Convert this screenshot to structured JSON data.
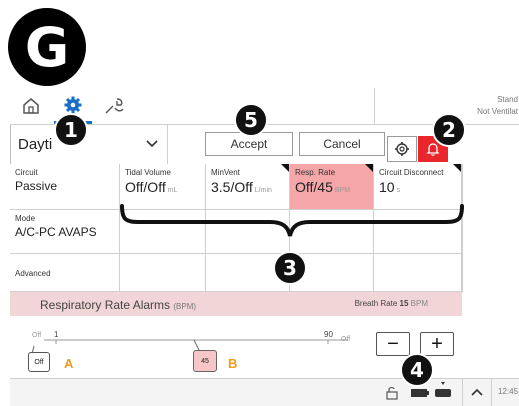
{
  "badge": "G",
  "callouts": {
    "c1": "1",
    "c2": "2",
    "c3": "3",
    "c4": "4",
    "c5": "5"
  },
  "status": {
    "line1": "Stand",
    "line2": "Not Ventilat"
  },
  "tabs": [
    {
      "icon": "home-icon"
    },
    {
      "icon": "gear-icon",
      "active": true
    },
    {
      "icon": "wrench-tool-icon"
    }
  ],
  "preset": {
    "value": "Dayti"
  },
  "actions": {
    "accept": "Accept",
    "cancel": "Cancel"
  },
  "colors": {
    "alarm_red": "#e8262b",
    "highlight_pink": "#f4a6a8",
    "tab_blue": "#1a6fc4",
    "marker_orange": "#f39a1f"
  },
  "rows": {
    "circuit": {
      "label": "Circuit",
      "value": "Passive"
    },
    "mode": {
      "label": "Mode",
      "value": "A/C-PC AVAPS"
    },
    "advanced": {
      "label": "Advanced"
    }
  },
  "settings": [
    {
      "label": "Tidal Volume",
      "value": "Off/Off",
      "unit": "mL"
    },
    {
      "label": "MinVent",
      "value": "3.5/Off",
      "unit": "L/min"
    },
    {
      "label": "Resp. Rate",
      "value": "Off/45",
      "unit": "BPM"
    },
    {
      "label": "Circuit Disconnect",
      "value": "10",
      "unit": "s"
    }
  ],
  "alarm_panel": {
    "title": "Respiratory Rate Alarms",
    "title_unit": "(BPM)",
    "breath_label": "Breath Rate",
    "breath_value": "15",
    "breath_unit": "BPM",
    "scale_min_label": "Off",
    "scale_min": "1",
    "scale_max": "90",
    "scale_max_label": "Off",
    "low_value": "Off",
    "high_value": "45",
    "marker_a": "A",
    "marker_b": "B",
    "minus": "−",
    "plus": "+"
  },
  "bottombar": {
    "time": "12:45"
  }
}
